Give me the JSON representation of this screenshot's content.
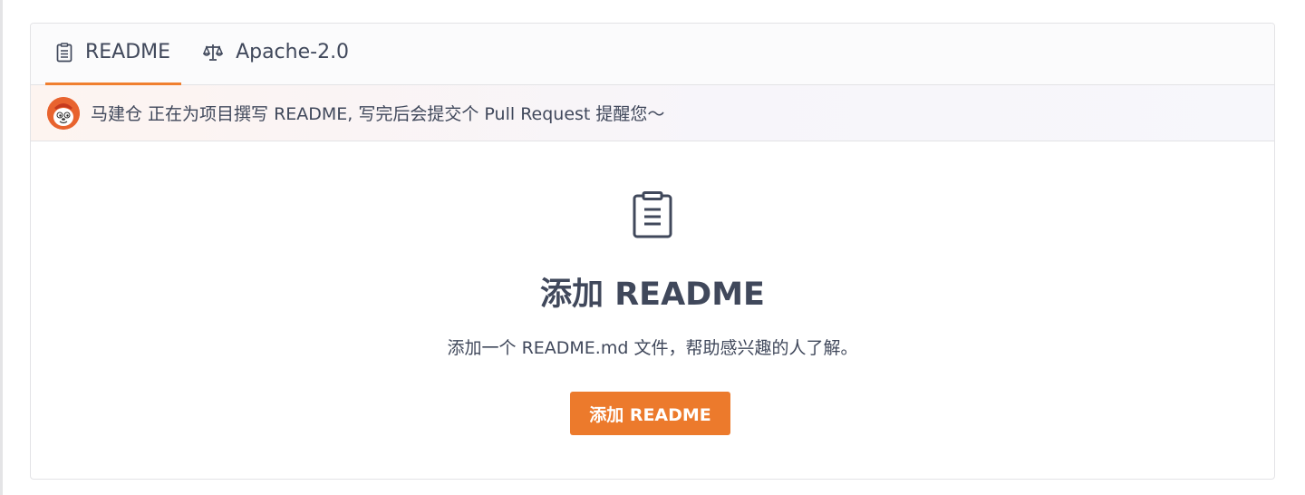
{
  "tabs": [
    {
      "label": "README",
      "icon": "document-icon",
      "active": true
    },
    {
      "label": "Apache-2.0",
      "icon": "scale-icon",
      "active": false
    }
  ],
  "notice": {
    "text": "马建仓 正在为项目撰写 README, 写完后会提交个 Pull Request 提醒您～"
  },
  "empty_state": {
    "icon": "document-icon",
    "title": "添加 README",
    "description": "添加一个 README.md 文件，帮助感兴趣的人了解。",
    "button_label": "添加 README"
  },
  "colors": {
    "accent": "#ec7a2c",
    "text": "#40485b",
    "border": "#e3e3e6"
  }
}
